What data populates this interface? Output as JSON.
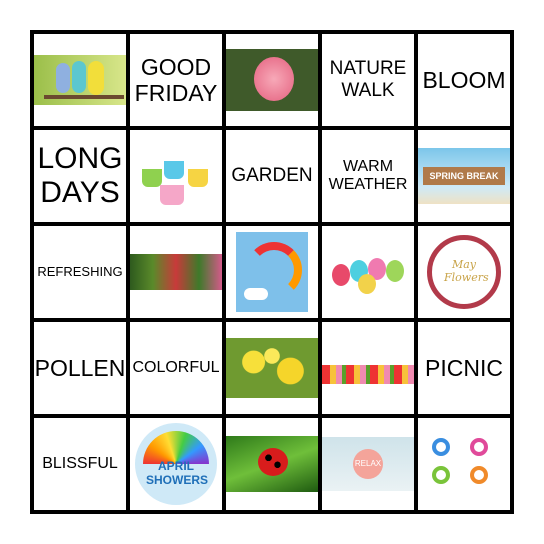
{
  "cells": [
    {
      "type": "image",
      "icon": "parakeets-image"
    },
    {
      "type": "text",
      "label": "GOOD FRIDAY"
    },
    {
      "type": "image",
      "icon": "pink-camellia-image"
    },
    {
      "type": "text",
      "label": "NATURE WALK"
    },
    {
      "type": "text",
      "label": "BLOOM"
    },
    {
      "type": "text",
      "label": "LONG DAYS"
    },
    {
      "type": "image",
      "icon": "easter-baskets-image"
    },
    {
      "type": "text",
      "label": "GARDEN"
    },
    {
      "type": "text",
      "label": "WARM WEATHER"
    },
    {
      "type": "image",
      "icon": "spring-break-sign-image",
      "caption": "SPRING BREAK"
    },
    {
      "type": "text",
      "label": "REFRESHING"
    },
    {
      "type": "image",
      "icon": "garden-flowers-image"
    },
    {
      "type": "image",
      "icon": "rainbow-image"
    },
    {
      "type": "image",
      "icon": "easter-eggs-image"
    },
    {
      "type": "image",
      "icon": "may-flowers-wreath-image",
      "caption": "May Flowers"
    },
    {
      "type": "text",
      "label": "POLLEN"
    },
    {
      "type": "text",
      "label": "COLORFUL"
    },
    {
      "type": "image",
      "icon": "daffodils-image"
    },
    {
      "type": "image",
      "icon": "tulips-image"
    },
    {
      "type": "text",
      "label": "PICNIC"
    },
    {
      "type": "text",
      "label": "BLISSFUL"
    },
    {
      "type": "image",
      "icon": "april-showers-umbrella-image",
      "caption": "APRIL SHOWERS"
    },
    {
      "type": "image",
      "icon": "ladybug-image"
    },
    {
      "type": "image",
      "icon": "relax-image",
      "caption": "RELAX"
    },
    {
      "type": "image",
      "icon": "snails-image"
    }
  ]
}
